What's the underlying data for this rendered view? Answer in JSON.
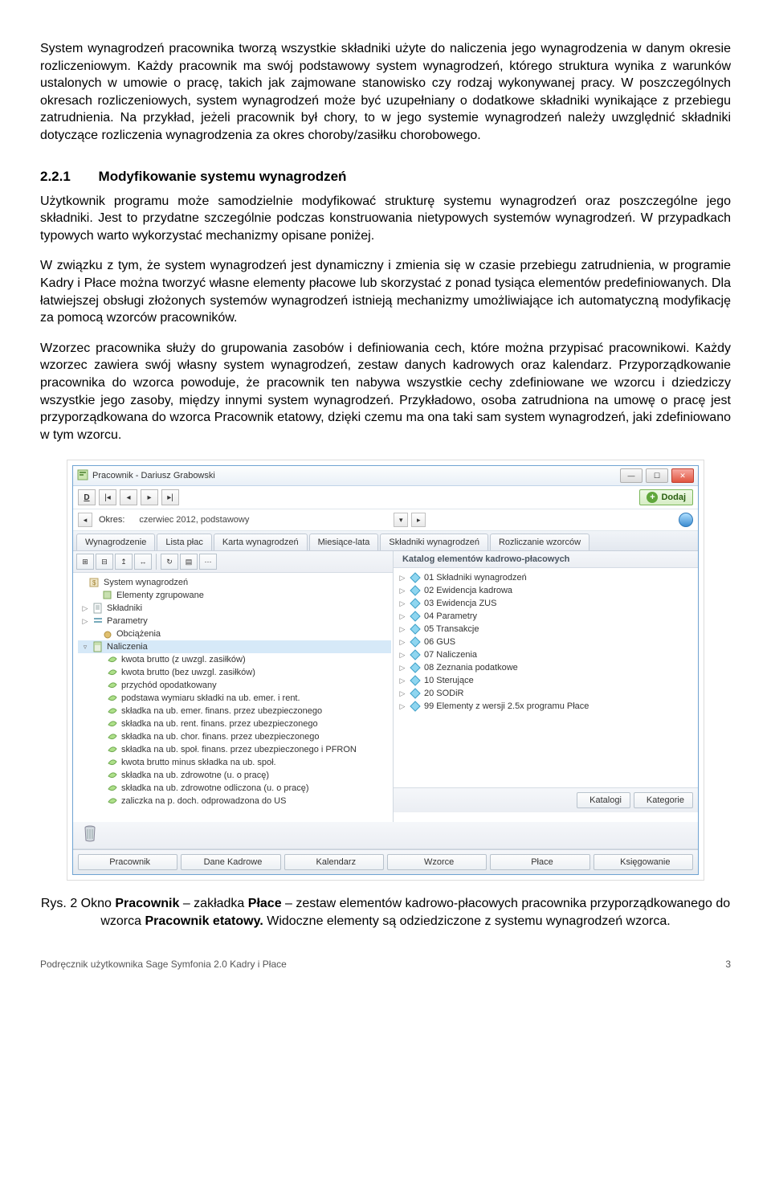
{
  "doc": {
    "para1": "System wynagrodzeń pracownika tworzą wszystkie składniki użyte do naliczenia jego wynagrodzenia w danym okresie rozliczeniowym. Każdy pracownik ma swój podstawowy system wynagrodzeń, którego struktura wynika z warunków ustalonych w umowie o pracę, takich jak zajmowane stanowisko czy rodzaj wykonywanej pracy. W poszczególnych okresach rozliczeniowych, system wynagrodzeń może być uzupełniany o dodatkowe składniki wynikające z przebiegu zatrudnienia. Na przykład, jeżeli pracownik był chory, to w jego systemie wynagrodzeń należy uwzględnić składniki dotyczące rozliczenia wynagrodzenia za okres choroby/zasiłku chorobowego.",
    "h_num": "2.2.1",
    "h_txt": "Modyfikowanie systemu wynagrodzeń",
    "para2": "Użytkownik programu może samodzielnie modyfikować strukturę systemu wynagrodzeń oraz poszczególne jego składniki. Jest to przydatne szczególnie podczas konstruowania nietypowych systemów wynagrodzeń. W przypadkach typowych warto wykorzystać mechanizmy opisane poniżej.",
    "para3": "W związku z tym, że system wynagrodzeń jest dynamiczny i zmienia się w czasie przebiegu zatrudnienia, w programie Kadry i Płace można tworzyć własne elementy płacowe lub skorzystać z ponad tysiąca elementów predefiniowanych. Dla łatwiejszej obsługi złożonych systemów wynagrodzeń istnieją mechanizmy umożliwiające ich automatyczną modyfikację za pomocą wzorców pracowników.",
    "para4": "Wzorzec pracownika służy do grupowania zasobów i definiowania cech, które można przypisać pracownikowi. Każdy wzorzec zawiera swój własny system wynagrodzeń, zestaw danych kadrowych oraz kalendarz. Przyporządkowanie pracownika do wzorca powoduje, że pracownik ten nabywa wszystkie cechy zdefiniowane we wzorcu i dziedziczy wszystkie jego zasoby, między innymi system wynagrodzeń. Przykładowo, osoba zatrudniona na umowę o pracę jest przyporządkowana do wzorca Pracownik etatowy, dzięki czemu ma ona taki sam system wynagrodzeń, jaki zdefiniowano w tym wzorcu.",
    "cap_pre": "Rys. 2 Okno ",
    "cap_b1": "Pracownik",
    "cap_mid1": " – zakładka ",
    "cap_b2": "Płace",
    "cap_mid2": " – zestaw elementów kadrowo-płacowych pracownika przyporządkowanego do wzorca ",
    "cap_b3": "Pracownik etatowy.",
    "cap_tail": " Widoczne elementy są odziedziczone z systemu wynagrodzeń wzorca.",
    "foot_left": "Podręcznik użytkownika Sage Symfonia 2.0 Kadry i Płace",
    "foot_pg": "3"
  },
  "win": {
    "title": "Pracownik - Dariusz Grabowski",
    "nav_D": "D",
    "period_lbl": "Okres:",
    "period_val": "czerwiec 2012, podstawowy",
    "add_lbl": "Dodaj",
    "tabs": {
      "t1": "Wynagrodzenie",
      "t2": "Lista płac",
      "t3": "Karta wynagrodzeń",
      "t4": "Miesiące-lata",
      "t5": "Składniki wynagrodzeń",
      "t6": "Rozliczanie wzorców"
    },
    "left_tree": {
      "n0": "System wynagrodzeń",
      "n1": "Elementy zgrupowane",
      "n2": "Składniki",
      "n3": "Parametry",
      "n4": "Obciążenia",
      "n5": "Naliczenia",
      "c0": "kwota brutto (z uwzgl. zasiłków)",
      "c1": "kwota brutto (bez uwzgl. zasiłków)",
      "c2": "przychód opodatkowany",
      "c3": "podstawa wymiaru składki na ub. emer. i rent.",
      "c4": "składka na ub. emer. finans. przez ubezpieczonego",
      "c5": "składka na ub. rent. finans. przez ubezpieczonego",
      "c6": "składka na ub. chor. finans. przez ubezpieczonego",
      "c7": "składka na ub. społ. finans. przez ubezpieczonego i PFRON",
      "c8": "kwota brutto minus składka na ub. społ.",
      "c9": "składka na ub. zdrowotne (u. o pracę)",
      "c10": "składka na ub. zdrowotne odliczona (u. o pracę)",
      "c11": "zaliczka na p. doch. odprowadzona do US"
    },
    "right_head": "Katalog elementów kadrowo-płacowych",
    "right_tree": {
      "r0": "01 Składniki wynagrodzeń",
      "r1": "02 Ewidencja kadrowa",
      "r2": "03 Ewidencja ZUS",
      "r3": "04 Parametry",
      "r4": "05 Transakcje",
      "r5": "06 GUS",
      "r6": "07 Naliczenia",
      "r7": "08 Zeznania podatkowe",
      "r8": "10 Sterujące",
      "r9": "20 SODiR",
      "r10": "99 Elementy z wersji 2.5x programu Płace"
    },
    "btn_katalogi": "Katalogi",
    "btn_kategorie": "Kategorie",
    "foot": {
      "f0": "Pracownik",
      "f1": "Dane Kadrowe",
      "f2": "Kalendarz",
      "f3": "Wzorce",
      "f4": "Płace",
      "f5": "Księgowanie"
    }
  }
}
